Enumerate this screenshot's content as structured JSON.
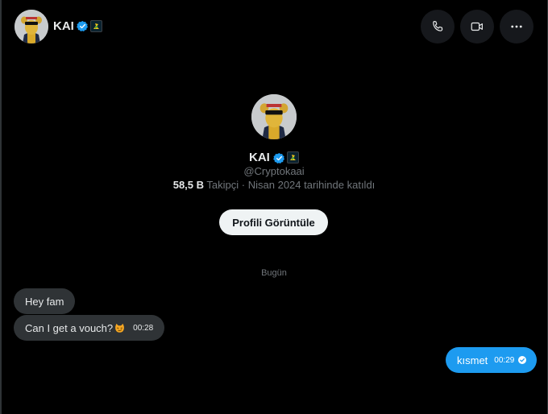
{
  "header": {
    "name": "KAI",
    "actions": {
      "call_icon": "phone-icon",
      "video_icon": "video-icon",
      "more_icon": "more-horizontal-icon"
    }
  },
  "profile": {
    "name": "KAI",
    "handle": "@Cryptokaai",
    "followers_count": "58,5 B",
    "followers_label": "Takipçi",
    "joined": "· Nisan 2024 tarihinde katıldı",
    "view_button": "Profili Görüntüle"
  },
  "conversation": {
    "day_separator": "Bugün",
    "messages": [
      {
        "direction": "incoming",
        "text": "Hey fam",
        "time": ""
      },
      {
        "direction": "incoming",
        "text": "Can I get a vouch?",
        "emoji": "smirking-cat-emoji",
        "time": "00:28"
      },
      {
        "direction": "outgoing",
        "text": "kısmet",
        "time": "00:29",
        "status_icon": "read-check-icon"
      }
    ]
  },
  "colors": {
    "background": "#000000",
    "accent": "#1d9bf0",
    "incoming_bubble": "#2f3336",
    "muted_text": "#71767b",
    "button_bg": "#eff3f4"
  }
}
